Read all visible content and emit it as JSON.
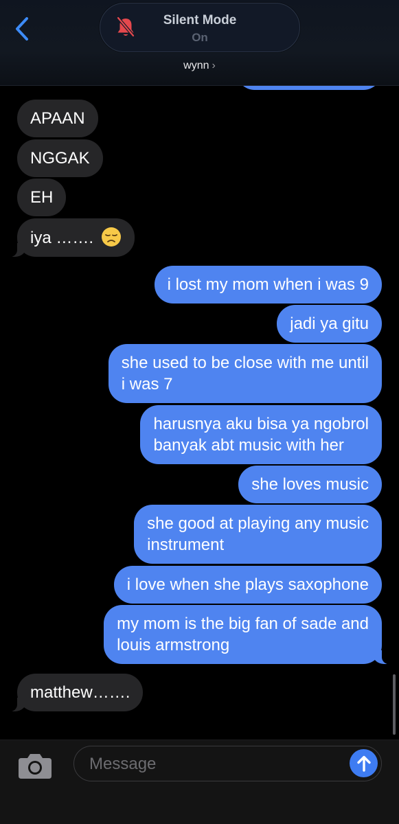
{
  "header": {
    "silent_title": "Silent Mode",
    "silent_state": "On",
    "contact": "wynn",
    "contact_chevron": "›"
  },
  "messages": [
    {
      "from": "them",
      "text": "APAAN"
    },
    {
      "from": "them",
      "text": "NGGAK"
    },
    {
      "from": "them",
      "text": "EH"
    },
    {
      "from": "them",
      "text": "iya ……. ",
      "emoji": "disappointed-face"
    },
    {
      "from": "me",
      "text": "i lost my mom when i was 9"
    },
    {
      "from": "me",
      "text": "jadi ya gitu"
    },
    {
      "from": "me",
      "lines": [
        "she used to be close with me until",
        "i was 7"
      ]
    },
    {
      "from": "me",
      "lines": [
        "harusnya aku bisa ya ngobrol",
        "banyak abt music with her"
      ]
    },
    {
      "from": "me",
      "text": "she loves music"
    },
    {
      "from": "me",
      "lines": [
        "she good at playing any music",
        "instrument"
      ]
    },
    {
      "from": "me",
      "text": "i love when she plays saxophone"
    },
    {
      "from": "me",
      "lines": [
        "my mom is the big fan of sade and",
        "louis armstrong"
      ]
    },
    {
      "from": "them",
      "text": "matthew……."
    }
  ],
  "composer": {
    "placeholder": "Message"
  },
  "colors": {
    "outgoing": "#4f84f0",
    "incoming": "#262628",
    "accent": "#3e7cf2",
    "silent_bell": "#e5484d"
  },
  "icons": [
    "back-chevron-icon",
    "bell-slash-icon",
    "camera-icon",
    "send-arrow-icon"
  ]
}
